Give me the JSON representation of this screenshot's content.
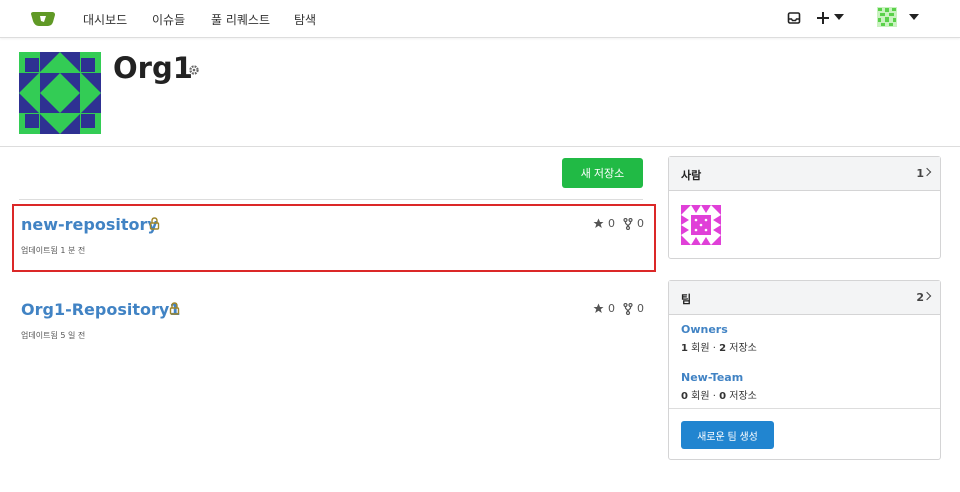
{
  "nav": {
    "links": [
      "대시보드",
      "이슈들",
      "풀 리퀘스트",
      "탐색"
    ],
    "right_icons": [
      "inbox-icon",
      "plus-icon",
      "user-avatar"
    ]
  },
  "org": {
    "name": "Org1"
  },
  "actions": {
    "new_repo_label": "새 저장소"
  },
  "repos": [
    {
      "name": "new-repository",
      "updated": "업데이트됨 1 분 전",
      "stars": "0",
      "forks": "0",
      "private": true
    },
    {
      "name": "Org1-Repository1",
      "updated": "업데이트됨 5 일 전",
      "stars": "0",
      "forks": "0",
      "private": true
    }
  ],
  "people_card": {
    "title": "사람",
    "count": "1"
  },
  "teams_card": {
    "title": "팀",
    "count": "2",
    "teams": [
      {
        "name": "Owners",
        "members": "1",
        "members_label": "회원",
        "repos": "2",
        "repos_label": "저장소"
      },
      {
        "name": "New-Team",
        "members": "0",
        "members_label": "회원",
        "repos": "0",
        "repos_label": "저장소"
      }
    ],
    "new_team_label": "새로운 팀 생성"
  },
  "colors": {
    "primary_green": "#21ba45",
    "link_blue": "#4183c4",
    "button_blue": "#2185d0",
    "selection_red": "#db2828"
  }
}
